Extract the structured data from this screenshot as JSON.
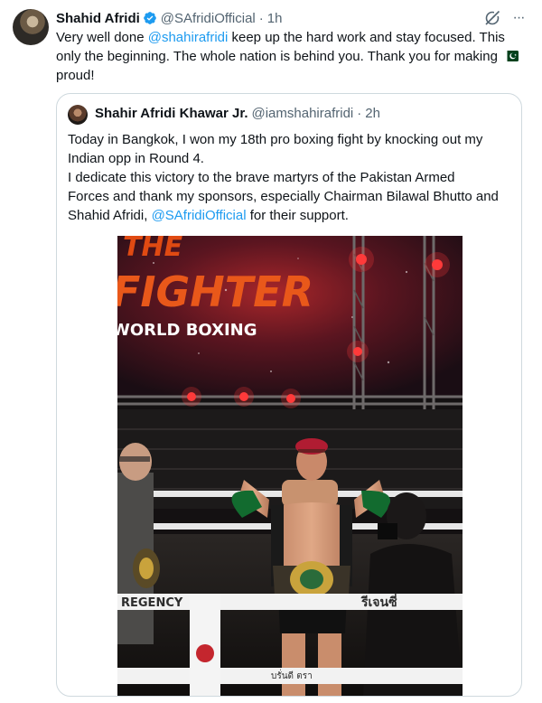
{
  "tweet": {
    "author_name": "Shahid Afridi",
    "author_handle": "@SAfridiOfficial",
    "separator": "·",
    "time": "1h",
    "text_parts": {
      "a": "Very well done ",
      "mention1": "@shahirafridi",
      "b": " keep up the hard work and stay focused. This only the beginning. The whole nation is behind you. Thank you for making ",
      "c": " proud!"
    },
    "flag_icon": "pakistan-flag-emoji"
  },
  "quoted": {
    "author_name": "Shahir Afridi Khawar Jr.",
    "author_handle": "@iamshahirafridi",
    "separator": "·",
    "time": "2h",
    "lines": [
      "Today in Bangkok, I won my 18th pro boxing fight by knocking out my",
      "Indian opp in Round 4.",
      "I dedicate this victory to the brave martyrs of the Pakistan Armed",
      "Forces and thank my sponsors, especially Chairman Bilawal Bhutto and",
      "Shahid Afridi, "
    ],
    "mention": "@SAfridiOfficial",
    "line_end": " for their support.",
    "photo_text": {
      "screen_title_1": "THE",
      "screen_title_2": "FIGHTER",
      "screen_subtitle": "WORLD BOXING",
      "banner_1": "REGENCY",
      "banner_2": "รีเจนซี่",
      "banner_small": "บรั่นดี ตรา"
    }
  },
  "colors": {
    "link": "#1d9bf0",
    "secondary_text": "#536471",
    "border": "#cfd9de"
  }
}
